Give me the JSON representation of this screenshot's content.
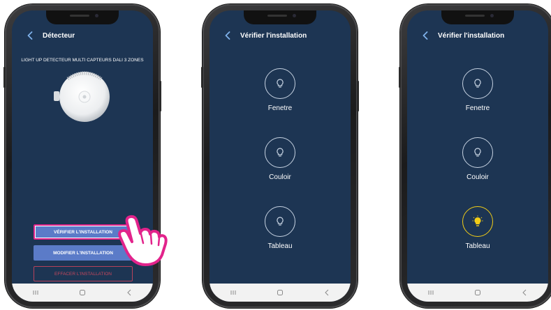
{
  "screen1": {
    "title": "Détecteur",
    "device_name": "LIGHT UP DETECTEUR MULTI CAPTEURS DALI 3 ZONES",
    "buttons": {
      "verify": "VÉRIFIER L'INSTALLATION",
      "modify": "MODIFIER L'INSTALLATION",
      "delete": "EFFACER L'INSTALLATION"
    }
  },
  "screen2": {
    "title": "Vérifier l'installation",
    "zones": [
      {
        "label": "Fenetre",
        "state": "off"
      },
      {
        "label": "Couloir",
        "state": "off"
      },
      {
        "label": "Tableau",
        "state": "off"
      }
    ]
  },
  "screen3": {
    "title": "Vérifier l'installation",
    "zones": [
      {
        "label": "Fenetre",
        "state": "off"
      },
      {
        "label": "Couloir",
        "state": "off"
      },
      {
        "label": "Tableau",
        "state": "on"
      }
    ]
  },
  "colors": {
    "screen_bg": "#1d3553",
    "button_primary": "#5b7bc8",
    "highlight": "#e2238b",
    "danger": "#c8485e",
    "bulb_on": "#f2cd17"
  }
}
